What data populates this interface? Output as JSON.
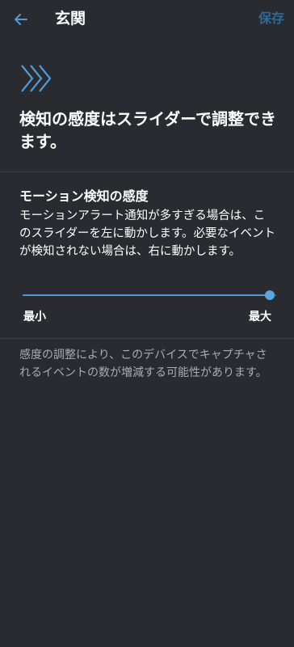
{
  "header": {
    "title": "玄関",
    "save_label": "保存",
    "back_icon": "arrow-left-icon"
  },
  "colors": {
    "background": "#2a2b30",
    "accent": "#4e9bd6",
    "save_disabled": "#2e6a96",
    "note_text": "#a9abb1"
  },
  "hero": {
    "icon": "chevrons-right-icon",
    "headline": "検知の感度はスライダーで調整できます。"
  },
  "sensitivity": {
    "title": "モーション検知の感度",
    "description": "モーションアラート通知が多すぎる場合は、このスライダーを左に動かします。必要なイベントが検知されない場合は、右に動かします。",
    "min_label": "最小",
    "max_label": "最大",
    "level": 1.0
  },
  "note": "感度の調整により、このデバイスでキャプチャされるイベントの数が増減する可能性があります。"
}
